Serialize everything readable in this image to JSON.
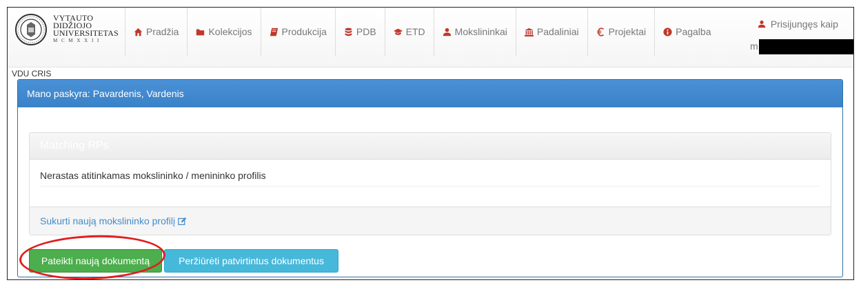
{
  "logo": {
    "line1": "VYTAUTO",
    "line2": "DIDŽIOJO",
    "line3": "UNIVERSITETAS",
    "line4": "M C M X X I I"
  },
  "nav": {
    "items": [
      {
        "label": "Pradžia",
        "icon": "home-icon"
      },
      {
        "label": "Kolekcijos",
        "icon": "folder-icon"
      },
      {
        "label": "Produkcija",
        "icon": "book-icon"
      },
      {
        "label": "PDB",
        "icon": "database-icon"
      },
      {
        "label": "ETD",
        "icon": "graduation-cap-icon"
      },
      {
        "label": "Mokslininkai",
        "icon": "user-icon"
      },
      {
        "label": "Padaliniai",
        "icon": "institution-icon"
      },
      {
        "label": "Projektai",
        "icon": "euro-icon"
      },
      {
        "label": "Pagalba",
        "icon": "info-circle-icon"
      }
    ],
    "user_label": "Prisijungęs kaip",
    "user_prefix": "m"
  },
  "breadcrumb": "VDU CRIS",
  "panel": {
    "title": "Mano paskyra: Pavardenis, Vardenis",
    "inner_title": "Matching RPs",
    "message": "Nerastas atitinkamas mokslininko / menininko profilis",
    "create_link": "Sukurti naują mokslininko profilį",
    "submit_button": "Pateikti naują dokumentą",
    "view_button": "Peržiūrėti patvirtintus dokumentus"
  },
  "colors": {
    "primary": "#3a82c8",
    "success": "#4cae4c",
    "info": "#46b8da",
    "highlight": "#e11e1e"
  }
}
